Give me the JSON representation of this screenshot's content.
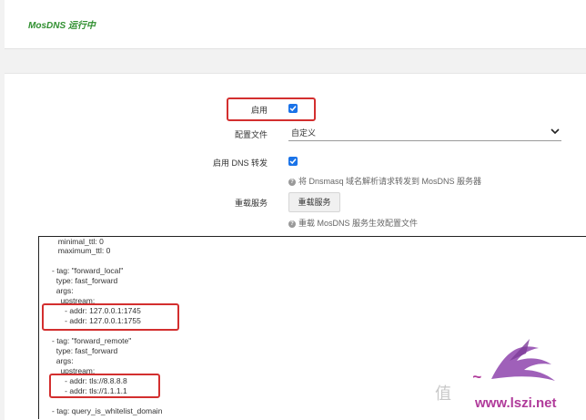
{
  "status": {
    "text": "MosDNS 运行中",
    "color": "#2f8f2f"
  },
  "settings": {
    "enable_label": "启用",
    "enable_checked": true,
    "config_file_label": "配置文件",
    "config_file_value": "自定义",
    "dns_forward_label": "启用 DNS 转发",
    "dns_forward_checked": true,
    "dns_forward_help": "将 Dnsmasq 域名解析请求转发到 MosDNS 服务器",
    "reload_label": "重载服务",
    "reload_button": "重载服务",
    "reload_help": "重载 MosDNS 服务生效配置文件"
  },
  "config_lines": [
    "  minimal_ttl: 0",
    "  maximum_ttl: 0",
    "",
    "- tag: \"forward_local\"",
    "  type: fast_forward",
    "  args:",
    "    upstream:",
    "      - addr: 127.0.0.1:1745",
    "      - addr: 127.0.0.1:1755",
    "",
    "- tag: \"forward_remote\"",
    "  type: fast_forward",
    "  args:",
    "    upstream:",
    "      - addr: tls://8.8.8.8",
    "      - addr: tls://1.1.1.1",
    "",
    "- tag: query_is_whitelist_domain"
  ],
  "watermark": {
    "text_cn": "值",
    "site": "www.lszi.net"
  },
  "colors": {
    "accent": "#1a73e8",
    "highlight": "#d32f2f"
  },
  "icons": {
    "checkbox": "check-icon",
    "select": "chevron-down-icon",
    "help": "help-icon"
  }
}
